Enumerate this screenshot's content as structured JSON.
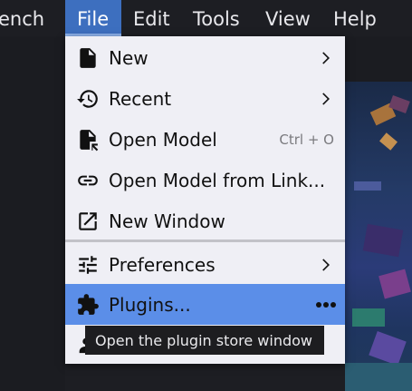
{
  "menubar": {
    "items": [
      {
        "label": "ench"
      },
      {
        "label": "File"
      },
      {
        "label": "Edit"
      },
      {
        "label": "Tools"
      },
      {
        "label": "View"
      },
      {
        "label": "Help"
      }
    ]
  },
  "file_menu": {
    "items": [
      {
        "label": "New",
        "icon": "file-icon",
        "submenu": true
      },
      {
        "label": "Recent",
        "icon": "history-icon",
        "submenu": true
      },
      {
        "label": "Open Model",
        "icon": "file-open-icon",
        "shortcut": "Ctrl + O"
      },
      {
        "label": "Open Model from Link...",
        "icon": "link-icon"
      },
      {
        "label": "New Window",
        "icon": "open-in-new-icon"
      },
      {
        "label": "Preferences",
        "icon": "tune-icon",
        "submenu": true
      },
      {
        "label": "Plugins...",
        "icon": "puzzle-icon",
        "more": true
      }
    ],
    "highlighted": "Plugins..."
  },
  "tooltip": {
    "text": "Open the plugin store window"
  },
  "colors": {
    "menubar_bg": "#1d1e23",
    "active_menu": "#3d6fbf",
    "menu_bg": "#efeff5",
    "highlight": "#5b8ee8",
    "tooltip_bg": "#1d1d20"
  }
}
